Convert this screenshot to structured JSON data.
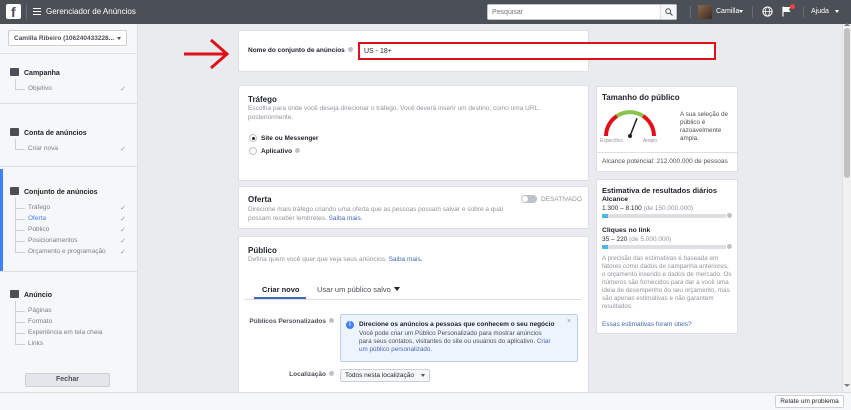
{
  "topbar": {
    "app_title": "Gerenciador de Anúncios",
    "search_placeholder": "Pesquisar",
    "user_name": "Camilla",
    "help_label": "Ajuda"
  },
  "sidebar": {
    "account_label": "Camilla Ribeiro (106240433228...",
    "sections": {
      "campaign": {
        "title": "Campanha",
        "items": [
          "Objetivo"
        ]
      },
      "account": {
        "title": "Conta de anúncios",
        "items": [
          "Criar nova"
        ]
      },
      "adset": {
        "title": "Conjunto de anúncios",
        "items": [
          "Tráfego",
          "Oferta",
          "Público",
          "Posicionamentos",
          "Orçamento e programação"
        ],
        "active_item": "Oferta"
      },
      "ad": {
        "title": "Anúncio",
        "items": [
          "Páginas",
          "Formato",
          "Experiência em tela cheia",
          "Links"
        ]
      }
    },
    "check_glyph": "✓",
    "close_label": "Fechar"
  },
  "adset_name": {
    "label": "Nome do conjunto de anúncios",
    "value": "US - 18+"
  },
  "traffic": {
    "title": "Tráfego",
    "description": "Escolha para onde você deseja direcionar o tráfego. Você deverá inserir um destino, como uma URL, posteriormente.",
    "options": [
      {
        "label": "Site ou Messenger",
        "selected": true
      },
      {
        "label": "Aplicativo",
        "selected": false
      }
    ]
  },
  "offer": {
    "title": "Oferta",
    "description_line1": "Direcione mais tráfego criando uma oferta que as pessoas possam salvar e sobre a qual",
    "description_line2": "possam receber lembretes.",
    "link": "Saiba mais.",
    "toggle_label": "DESATIVADO"
  },
  "audience": {
    "title": "Público",
    "description": "Defina quem você quer que veja seus anúncios.",
    "link": "Saiba mais.",
    "tabs": [
      "Criar novo",
      "Usar um público salvo"
    ],
    "custom_audiences_label": "Públicos Personalizados",
    "info_title": "Direcione os anúncios a pessoas que conhecem o seu negócio",
    "info_body": "Você pode criar um Público Personalizado para mostrar anúncios para seus contatos, visitantes do site ou usuários do aplicativo.",
    "info_link": "Criar um público personalizado.",
    "info_close": "×",
    "location_label": "Localização",
    "location_value": "Todos nesta localização"
  },
  "audience_size": {
    "title": "Tamanho do público",
    "low_label": "Específico",
    "high_label": "Amplo",
    "gauge_position": 0.62,
    "summary": "A sua seleção de público é razoavelmente ampla.",
    "potential_reach": "Alcance potencial: 212.000.000 de pessoas"
  },
  "daily_estimates": {
    "title": "Estimativa de resultados diários",
    "reach_title": "Alcance",
    "reach_value": "1.300 – 8.100",
    "reach_total": "(de 150.000.000)",
    "reach_fraction": 0.05,
    "clicks_title": "Cliques no link",
    "clicks_value": "35 – 220",
    "clicks_total": "(de 5.000.000)",
    "clicks_fraction": 0.05,
    "note": "A precisão das estimativas é baseada em fatores como dados de campanha anteriores, o orçamento inserido e dados de mercado. Os números são fornecidos para dar a você uma ideia de desempenho do seu orçamento, mas são apenas estimativas e não garantem resultados.",
    "accuracy_link": "Essas estimativas foram úteis?"
  },
  "footer": {
    "report_button": "Relate um problema"
  },
  "colors": {
    "topbar": "#4b4f56",
    "accent": "#4080ff",
    "highlight": "#e0101b",
    "link": "#4267b2"
  }
}
